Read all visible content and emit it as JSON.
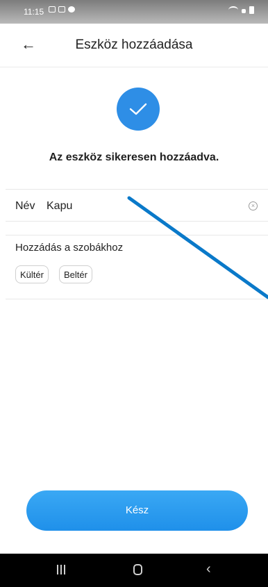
{
  "status_bar": {
    "time": "11:15"
  },
  "header": {
    "title": "Eszköz hozzáadása"
  },
  "success_message": "Az eszköz sikeresen hozzáadva.",
  "name_field": {
    "label": "Név",
    "value": "Kapu"
  },
  "rooms": {
    "label": "Hozzádás a szobákhoz",
    "chips": [
      "Kültér",
      "Beltér"
    ]
  },
  "done_button": {
    "label": "Kész"
  },
  "colors": {
    "accent": "#2e8ee6",
    "button": "#2196f3",
    "annotation_line": "#0a79c9"
  }
}
